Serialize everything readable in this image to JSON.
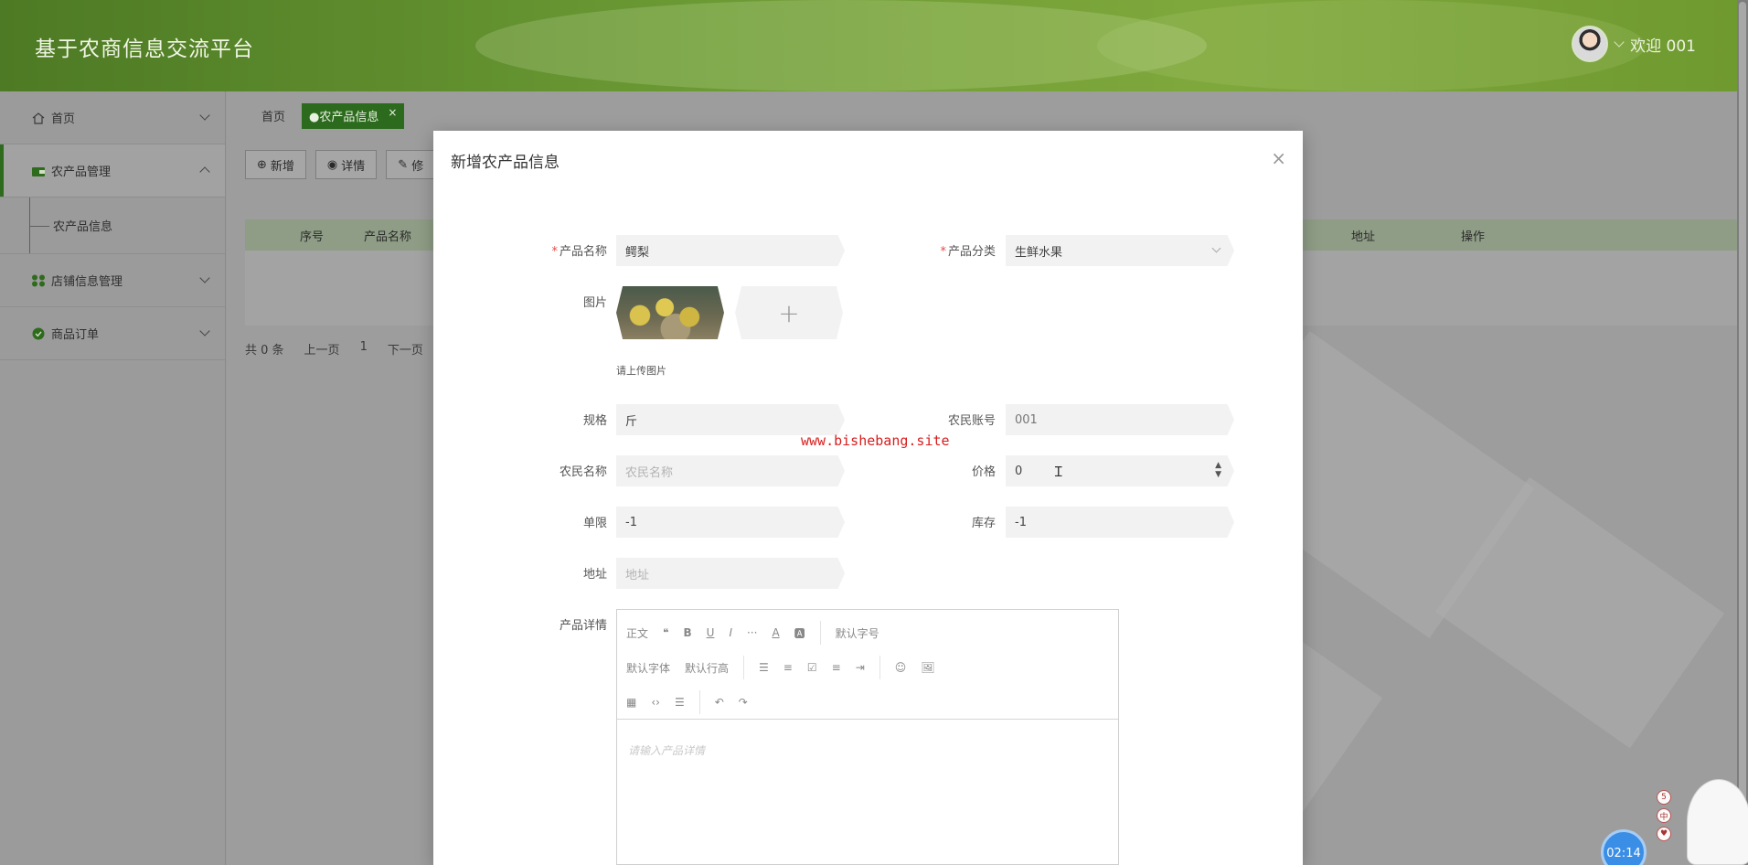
{
  "header": {
    "title": "基于农商信息交流平台",
    "welcome": "欢迎 001"
  },
  "sidebar": {
    "items": [
      {
        "label": "首页"
      },
      {
        "label": "农产品管理"
      },
      {
        "label": "农产品信息"
      },
      {
        "label": "店铺信息管理"
      },
      {
        "label": "商品订单"
      }
    ]
  },
  "tabs": {
    "home": "首页",
    "active": "●农产品信息",
    "close": "×"
  },
  "toolbar": {
    "add": "新增",
    "detail": "详情",
    "edit": "修"
  },
  "table": {
    "headers": [
      "序号",
      "产品名称",
      "地址",
      "操作"
    ]
  },
  "pager": {
    "total": "共 0 条",
    "prev": "上一页",
    "page": "1",
    "next": "下一页"
  },
  "modal": {
    "title": "新增农产品信息",
    "close": "×",
    "fields": {
      "product_name": {
        "label": "产品名称",
        "value": "鳄梨"
      },
      "category": {
        "label": "产品分类",
        "value": "生鲜水果"
      },
      "image": {
        "label": "图片",
        "hint": "请上传图片",
        "add": "+"
      },
      "spec": {
        "label": "规格",
        "value": "斤"
      },
      "farmer_account": {
        "label": "农民账号",
        "value": "001"
      },
      "farmer_name": {
        "label": "农民名称",
        "placeholder": "农民名称"
      },
      "price": {
        "label": "价格",
        "value": "0"
      },
      "limit": {
        "label": "单限",
        "value": "-1"
      },
      "stock": {
        "label": "库存",
        "value": "-1"
      },
      "address": {
        "label": "地址",
        "placeholder": "地址"
      },
      "detail": {
        "label": "产品详情",
        "placeholder": "请输入产品详情"
      }
    },
    "required_mark": "*"
  },
  "editor": {
    "row1": [
      "正文",
      "❝",
      "B",
      "U",
      "I",
      "···",
      "A",
      "🅰",
      "默认字号"
    ],
    "row2": [
      "默认字体",
      "默认行高",
      "☰",
      "≡",
      "☑",
      "≡",
      "⇥",
      "☺",
      "🖼"
    ],
    "row3": [
      "▦",
      "‹›",
      "☰",
      "↶",
      "↷"
    ]
  },
  "watermark": "www.bishebang.site",
  "timer": "02:14",
  "widgets": [
    "5",
    "中",
    "♥"
  ]
}
